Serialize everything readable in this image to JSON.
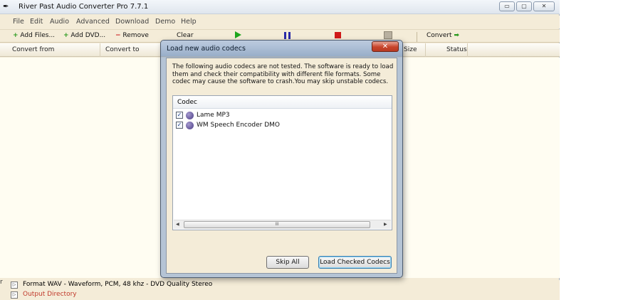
{
  "window": {
    "title": "River Past Audio Converter Pro 7.7.1",
    "controls": {
      "minimize": "▭",
      "maximize": "▢",
      "close": "✕"
    }
  },
  "menu": [
    "File",
    "Edit",
    "Audio",
    "Advanced",
    "Download",
    "Demo",
    "Help"
  ],
  "toolbar": {
    "add_files": "Add Files...",
    "add_dvd": "Add DVD...",
    "remove": "Remove",
    "clear": "Clear",
    "convert": "Convert",
    "icons": {
      "play": "play-icon",
      "pause": "pause-icon",
      "stop": "stop-icon",
      "calendar": "calendar-icon"
    }
  },
  "grid": {
    "columns": [
      "Convert from",
      "Convert to",
      "Size",
      "Status"
    ]
  },
  "status": {
    "format": "Format WAV - Waveform, PCM, 48 khz - DVD Quality Stereo",
    "output_dir": "Output Directory",
    "left_edge": "r"
  },
  "dialog": {
    "title": "Load new audio codecs",
    "description": "The following audio codecs are not tested. The software is ready to load them and check their compatibility with different file formats. Some codec may cause the software to crash.You may skip unstable codecs.",
    "list_header": "Codec",
    "codecs": [
      {
        "name": "Lame MP3",
        "checked": true
      },
      {
        "name": "WM Speech Encoder DMO",
        "checked": true
      }
    ],
    "scroll_thumb": "III",
    "skip_all": "Skip All",
    "load_checked": "Load Checked Codecs",
    "close": "✕"
  },
  "colors": {
    "background": "#f4ecd8",
    "grid_body": "#fffdf2",
    "accent_green": "#2a9a1e",
    "accent_red": "#cc1d1d"
  }
}
